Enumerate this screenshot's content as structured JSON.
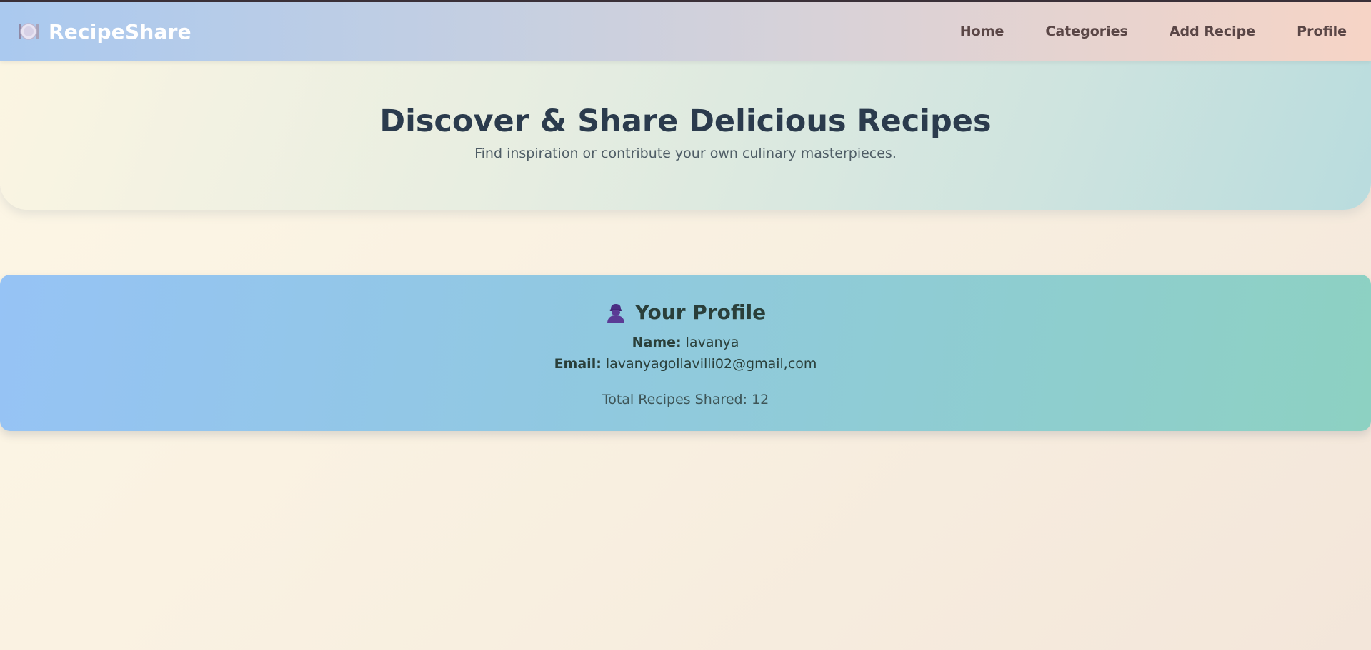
{
  "navbar": {
    "brand_icon": "plate-icon",
    "brand": "RecipeShare",
    "links": [
      "Home",
      "Categories",
      "Add Recipe",
      "Profile"
    ]
  },
  "hero": {
    "title": "Discover & Share Delicious Recipes",
    "subtitle": "Find inspiration or contribute your own culinary masterpieces."
  },
  "profile": {
    "icon": "user-icon",
    "title": "Your Profile",
    "name_label": "Name:",
    "name_value": "lavanya",
    "email_label": "Email:",
    "email_value": "lavanyagollavilli02@gmail,com",
    "total_text": "Total Recipes Shared: 12"
  },
  "colors": {
    "brand_text": "#ffffff",
    "nav_text": "#5a4646",
    "hero_title": "#2b3b4d",
    "profile_icon": "#4b2e83"
  }
}
